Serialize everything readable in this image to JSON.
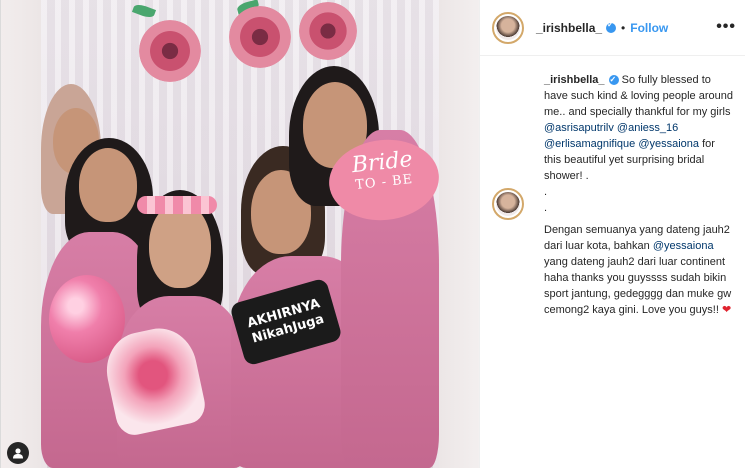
{
  "account": {
    "username": "_irishbella_",
    "follow_label": "Follow",
    "separator": "•",
    "more_label": "•••"
  },
  "photo": {
    "sign_akhirnya_line1": "AKHIRNYA",
    "sign_akhirnya_line2": "NikahJuga",
    "sign_bride_line1": "Bride",
    "sign_bride_line2": "TO - BE"
  },
  "caption": {
    "username": "_irishbella_",
    "text1": " So fully blessed to have such kind & loving people around me.. and specially thankful for my girls ",
    "mention1": "@asrisaputrilv",
    "mention2": "@aniess_16",
    "mention3": "@erlisamagnifique",
    "mention4": "@yessaiona",
    "text2": " for this beautiful yet surprising bridal shower! .",
    "dot1": ".",
    "dot2": "."
  },
  "comment2": {
    "text1": "Dengan semuanya yang dateng jauh2 dari luar kota, bahkan ",
    "mention": "@yessaiona",
    "text2": " yang dateng jauh2 dari luar continent haha thanks you guyssss sudah bikin sport jantung, gedegggg dan muke gw cemong2 kaya gini. Love you guys!! ",
    "heart": "❤"
  },
  "colors": {
    "accent": "#3897f0",
    "mention": "#00376b",
    "heart": "#e0242f"
  }
}
